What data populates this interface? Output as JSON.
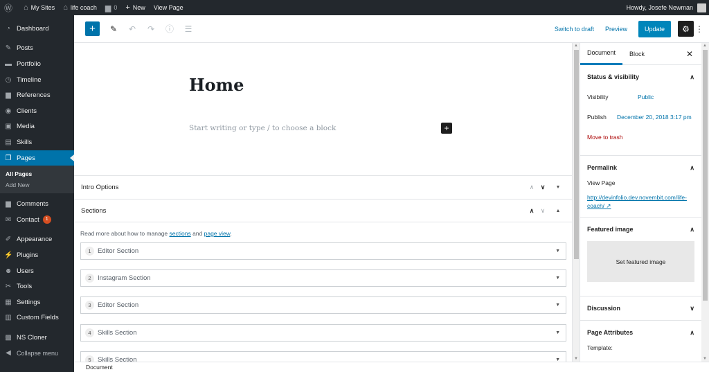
{
  "admin_bar": {
    "wp_icon": "wordpress-icon",
    "my_sites": "My Sites",
    "site_name": "life coach",
    "comments_count": "0",
    "new_label": "New",
    "view_page": "View Page",
    "howdy": "Howdy, Josefe Newman"
  },
  "sidebar": {
    "items": [
      {
        "label": "Dashboard",
        "icon": "dashboard-icon"
      },
      {
        "label": "Posts",
        "icon": "pin-icon"
      },
      {
        "label": "Portfolio",
        "icon": "folder-icon"
      },
      {
        "label": "Timeline",
        "icon": "history-icon"
      },
      {
        "label": "References",
        "icon": "comment-icon"
      },
      {
        "label": "Clients",
        "icon": "user-circle-icon"
      },
      {
        "label": "Media",
        "icon": "media-icon"
      },
      {
        "label": "Skills",
        "icon": "skills-icon"
      },
      {
        "label": "Pages",
        "icon": "pages-icon"
      }
    ],
    "submenu": [
      "All Pages",
      "Add New"
    ],
    "items2": [
      {
        "label": "Comments",
        "icon": "comment-icon"
      },
      {
        "label": "Contact",
        "icon": "mail-icon",
        "badge": "1"
      }
    ],
    "items3": [
      {
        "label": "Appearance",
        "icon": "brush-icon"
      },
      {
        "label": "Plugins",
        "icon": "plug-icon"
      },
      {
        "label": "Users",
        "icon": "users-icon"
      },
      {
        "label": "Tools",
        "icon": "wrench-icon"
      },
      {
        "label": "Settings",
        "icon": "settings-icon"
      },
      {
        "label": "Custom Fields",
        "icon": "grid-icon"
      }
    ],
    "items4": [
      {
        "label": "NS Cloner",
        "icon": "cloner-icon"
      },
      {
        "label": "Collapse menu",
        "icon": "collapse-icon"
      }
    ]
  },
  "toolbar": {
    "switch_draft": "Switch to draft",
    "preview": "Preview",
    "update": "Update"
  },
  "editor": {
    "title": "Home",
    "placeholder": "Start writing or type / to choose a block"
  },
  "metaboxes": {
    "intro_options": "Intro Options",
    "sections": "Sections",
    "help_prefix": "Read more about how to manage ",
    "help_link1": "sections",
    "help_and": " and ",
    "help_link2": "page view",
    "help_suffix": ".",
    "section_list": [
      {
        "num": "1",
        "label": "Editor Section"
      },
      {
        "num": "2",
        "label": "Instagram Section"
      },
      {
        "num": "3",
        "label": "Editor Section"
      },
      {
        "num": "4",
        "label": "Skills Section"
      },
      {
        "num": "5",
        "label": "Skills Section"
      }
    ]
  },
  "footer": {
    "breadcrumb": "Document"
  },
  "panel": {
    "tab_document": "Document",
    "tab_block": "Block",
    "status_title": "Status & visibility",
    "visibility_label": "Visibility",
    "visibility_value": "Public",
    "publish_label": "Publish",
    "publish_value": "December 20, 2018 3:17 pm",
    "move_trash": "Move to trash",
    "permalink_title": "Permalink",
    "view_page": "View Page",
    "permalink_url_1": "http://devinfolio.dev.novembit.com/life-",
    "permalink_url_2": "coach/",
    "featured_title": "Featured image",
    "set_featured": "Set featured image",
    "discussion_title": "Discussion",
    "page_attributes_title": "Page Attributes",
    "template_label": "Template:"
  },
  "colors": {
    "admin_dark": "#23282d",
    "accent_blue": "#0073aa",
    "update_blue": "#0085ba",
    "danger_red": "#a00",
    "badge_orange": "#d54e21"
  }
}
